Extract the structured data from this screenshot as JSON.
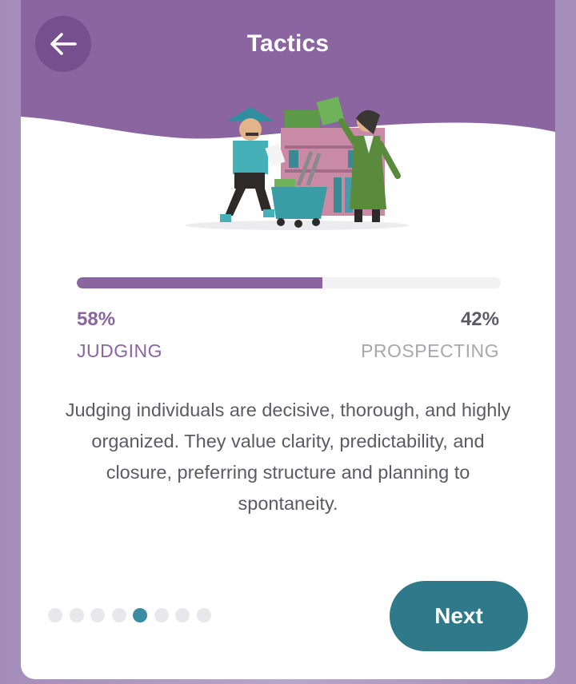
{
  "header": {
    "title": "Tactics",
    "back_icon": "arrow-left-icon",
    "bg_color": "#8a65a0"
  },
  "illustration": {
    "icon": "shopping-scene-illustration"
  },
  "result": {
    "left_percent_label": "58%",
    "right_percent_label": "42%",
    "left_trait": "JUDGING",
    "right_trait": "PROSPECTING",
    "fill_fraction": 0.58,
    "accent_color": "#8a65a0"
  },
  "description": "Judging individuals are decisive, thorough, and highly organized. They value clarity, predictability, and closure, preferring structure and planning to spontaneity.",
  "pagination": {
    "total": 8,
    "active_index": 4,
    "active_color": "#3b8ca3"
  },
  "footer": {
    "next_label": "Next",
    "next_color": "#2f7a8a"
  }
}
